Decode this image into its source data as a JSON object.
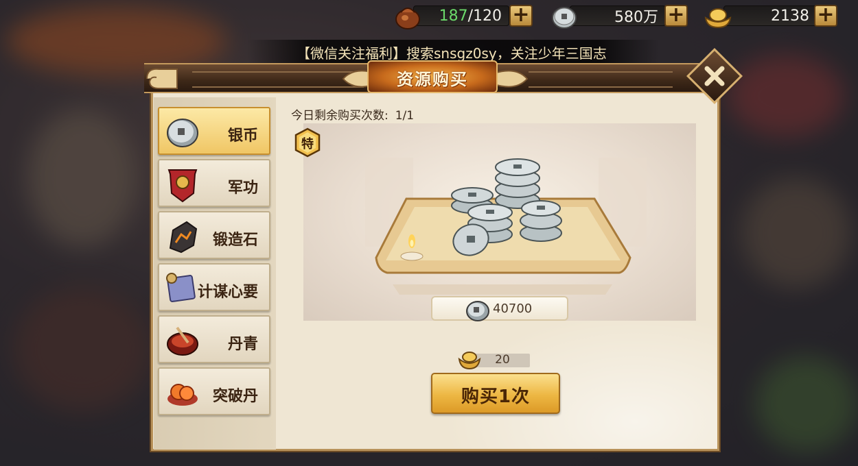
{
  "resources": {
    "stamina_current": "187",
    "stamina_max": "/120",
    "silver": "580万",
    "gold": "2138",
    "plus_label": "+"
  },
  "marquee": {
    "text": "【微信关注福利】搜索snsgz0sy，关注少年三国志"
  },
  "dialog": {
    "title": "资源购买"
  },
  "sidebar": {
    "items": [
      {
        "label": "银币",
        "icon": "silver-coin-icon",
        "active": true
      },
      {
        "label": "军功",
        "icon": "military-merit-banner-icon",
        "active": false
      },
      {
        "label": "锻造石",
        "icon": "forging-stone-icon",
        "active": false
      },
      {
        "label": "计谋心要",
        "icon": "strategy-scroll-icon",
        "active": false
      },
      {
        "label": "丹青",
        "icon": "paint-bowl-icon",
        "active": false
      },
      {
        "label": "突破丹",
        "icon": "breakthrough-pill-icon",
        "active": false
      }
    ]
  },
  "content": {
    "remaining_label": "今日剩余购买次数:",
    "remaining_value": "1/1",
    "special_badge": "特",
    "item_amount": "40700",
    "price": "20",
    "buy_label": "购买1次"
  },
  "colors": {
    "accent_gold": "#edb743",
    "stamina_green": "#6bd96a",
    "frame_brown": "#3d2818",
    "panel_bg": "#efe6d3"
  }
}
